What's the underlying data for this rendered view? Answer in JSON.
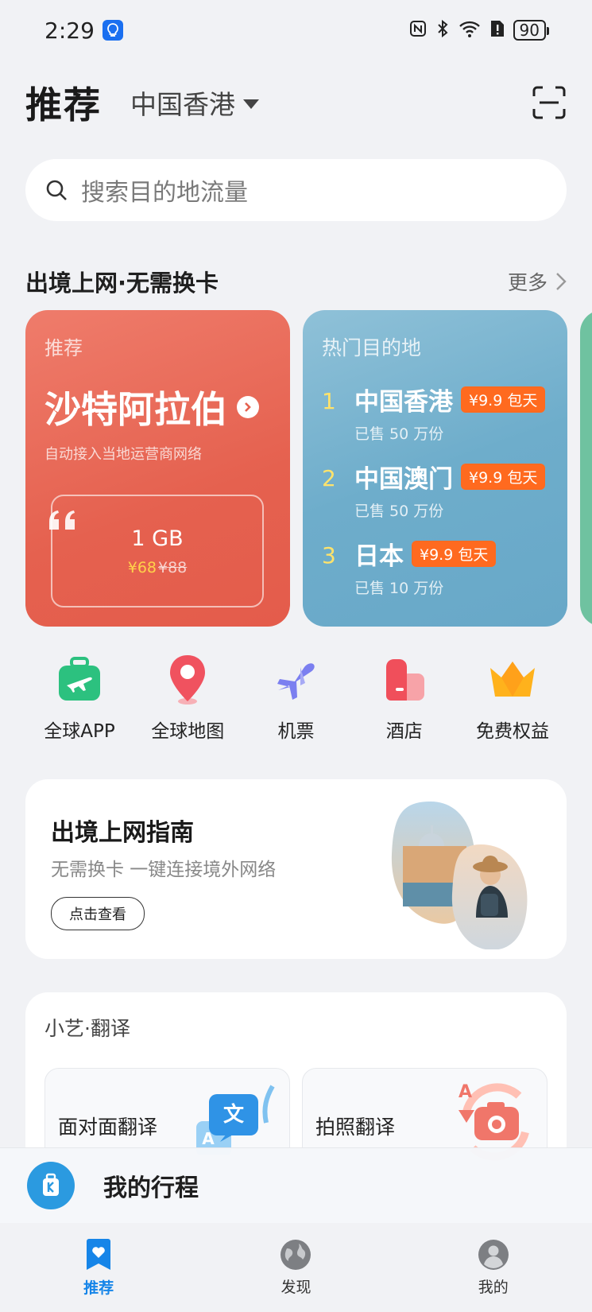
{
  "status": {
    "time": "2:29",
    "battery": "90"
  },
  "header": {
    "title": "推荐",
    "region": "中国香港"
  },
  "search": {
    "placeholder": "搜索目的地流量"
  },
  "section": {
    "title": "出境上网·无需换卡",
    "more": "更多"
  },
  "recommend_card": {
    "tag": "推荐",
    "country": "沙特阿拉伯",
    "subtitle": "自动接入当地运营商网络",
    "plan_size": "1 GB",
    "price_now": "¥68",
    "price_old": "¥88"
  },
  "hot_card": {
    "tag": "热门目的地",
    "items": [
      {
        "rank": "1",
        "name": "中国香港",
        "offer": "¥9.9 包天",
        "sold": "已售 50 万份"
      },
      {
        "rank": "2",
        "name": "中国澳门",
        "offer": "¥9.9 包天",
        "sold": "已售 50 万份"
      },
      {
        "rank": "3",
        "name": "日本",
        "offer": "¥9.9 包天",
        "sold": "已售 10 万份"
      }
    ]
  },
  "quick": {
    "items": [
      {
        "label": "全球APP",
        "icon": "luggage-plane-icon"
      },
      {
        "label": "全球地图",
        "icon": "map-pin-icon"
      },
      {
        "label": "机票",
        "icon": "airplane-icon"
      },
      {
        "label": "酒店",
        "icon": "hotel-icon"
      },
      {
        "label": "免费权益",
        "icon": "crown-icon"
      }
    ]
  },
  "guide": {
    "title": "出境上网指南",
    "subtitle": "无需换卡 一键连接境外网络",
    "button": "点击查看"
  },
  "translate": {
    "title": "小艺·翻译",
    "tiles": [
      {
        "label": "面对面翻译",
        "icon": "face-translate-icon"
      },
      {
        "label": "拍照翻译",
        "icon": "photo-translate-icon"
      }
    ]
  },
  "trip": {
    "label": "我的行程"
  },
  "tabs": [
    {
      "label": "推荐",
      "active": true
    },
    {
      "label": "发现",
      "active": false
    },
    {
      "label": "我的",
      "active": false
    }
  ],
  "colors": {
    "accent": "#1685e8",
    "rec_card": "#e5614f",
    "hot_card": "#6eadcb",
    "offer_tag": "#ff6a1f"
  }
}
